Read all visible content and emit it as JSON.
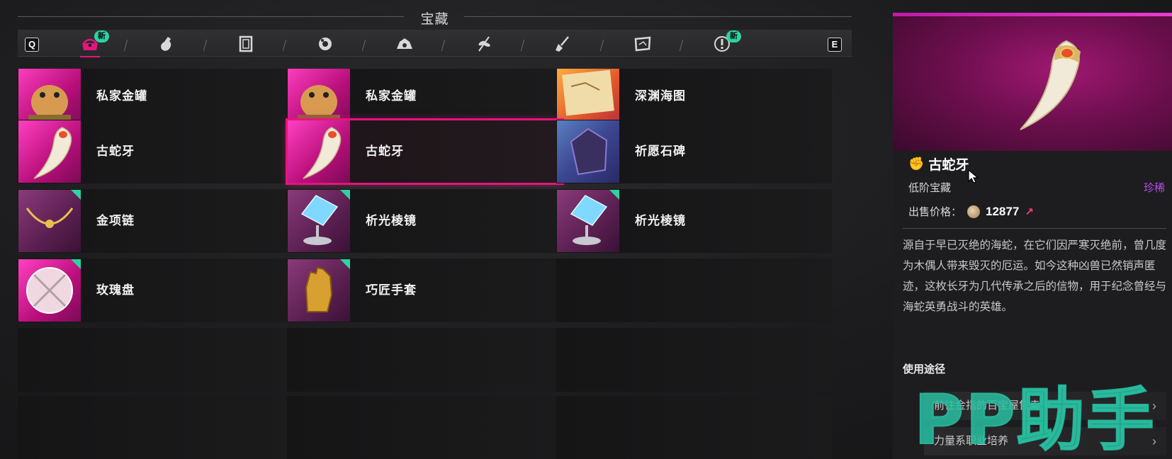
{
  "header": {
    "title": "宝藏"
  },
  "tabbar": {
    "left_key": "Q",
    "right_key": "E",
    "badge_new": "新",
    "tabs": [
      {
        "icon": "treasure-chest-icon",
        "active": true,
        "new": true
      },
      {
        "icon": "potion-bottle-icon"
      },
      {
        "icon": "scroll-frame-icon"
      },
      {
        "icon": "gear-flower-icon"
      },
      {
        "icon": "cog-cluster-icon"
      },
      {
        "icon": "herb-leaf-icon"
      },
      {
        "icon": "shovel-icon"
      },
      {
        "icon": "map-icon"
      },
      {
        "icon": "alert-icon",
        "new": true
      }
    ]
  },
  "items": [
    {
      "name": "私家金罐",
      "thumb": "pink",
      "art": "hamster"
    },
    {
      "name": "私家金罐",
      "thumb": "pink",
      "art": "hamster"
    },
    {
      "name": "深渊海图",
      "thumb": "orange",
      "art": "map"
    },
    {
      "name": "古蛇牙",
      "thumb": "pink",
      "art": "fang"
    },
    {
      "name": "古蛇牙",
      "thumb": "pink",
      "art": "fang",
      "selected": true
    },
    {
      "name": "祈愿石碑",
      "thumb": "blue",
      "art": "stone"
    },
    {
      "name": "金项链",
      "thumb": "dark",
      "art": "necklace",
      "corner": true
    },
    {
      "name": "析光棱镜",
      "thumb": "dark",
      "art": "prism",
      "corner": true
    },
    {
      "name": "析光棱镜",
      "thumb": "dark",
      "art": "prism",
      "corner": true
    },
    {
      "name": "玫瑰盘",
      "thumb": "pink",
      "art": "plate",
      "corner": true
    },
    {
      "name": "巧匠手套",
      "thumb": "dark",
      "art": "glove",
      "corner": true
    },
    {
      "name": ""
    },
    {
      "name": ""
    },
    {
      "name": ""
    },
    {
      "name": ""
    },
    {
      "name": ""
    },
    {
      "name": ""
    },
    {
      "name": ""
    }
  ],
  "detail": {
    "name": "古蛇牙",
    "tier": "低阶宝藏",
    "rarity": "珍稀",
    "price_label": "出售价格：",
    "price_value": "12877",
    "description": "源自于早已灭绝的海蛇，在它们因严寒灭绝前，曾几度为木偶人带来毁灭的厄运。如今这种凶兽已然销声匿迹，这枚长牙为几代传承之后的信物，用于纪念曾经与海蛇英勇战斗的英雄。",
    "usage_title": "使用途径",
    "usages": [
      "前往金指的百宝屋售卖",
      "力量系职业培养"
    ]
  },
  "watermark": "PP助手",
  "colors": {
    "accent": "#e4157d",
    "new_badge": "#2bd4a4",
    "rarity": "#b84ee8"
  }
}
